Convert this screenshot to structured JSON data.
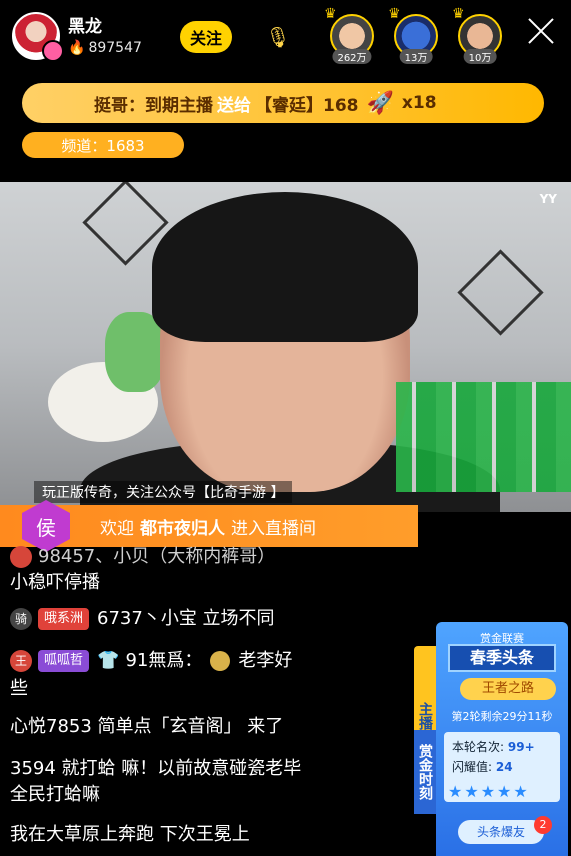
{
  "header": {
    "host_name": "黑龙",
    "host_fans": "897547",
    "follow_label": "关注",
    "viewers": [
      {
        "count": "262万"
      },
      {
        "count": "13万"
      },
      {
        "count": "10万"
      }
    ]
  },
  "gift_banner": {
    "sender": "挺哥：到期主播",
    "action": "送给",
    "receiver": "【睿廷】168",
    "quantity": "x18"
  },
  "channel": {
    "label": "频道：1683"
  },
  "video": {
    "logo": "YY",
    "promo": "玩正版传奇，关注公众号【比奇手游 】"
  },
  "welcome": {
    "badge": "侯",
    "prefix": "欢迎",
    "user": "都市夜归人",
    "suffix": "进入直播间"
  },
  "chat": [
    {
      "text": "98457、小贝（大称内裤哥）"
    },
    {
      "text": "小稳吓停播"
    },
    {
      "level": "骑",
      "tag": "哦系洲",
      "text": "6737丶小宝 立场不同"
    },
    {
      "level": "王",
      "tag": "呱呱哲",
      "user": "91無爲：",
      "text": "老李好"
    },
    {
      "text": "些"
    },
    {
      "text": "心悦7853 简单点「玄音阁」 来了"
    },
    {
      "text": "3594 就打蛤 嘛！以前故意碰瓷老毕"
    },
    {
      "text": "全民打蛤嘛"
    },
    {
      "text": "我在大草原上奔跑 下次王冕上"
    }
  ],
  "side_panel": {
    "tab1": "主播头条",
    "tab2": "赏金时刻",
    "title": "赏金联赛",
    "brand": "春季头条",
    "road": "王者之路",
    "round": "第2轮剩余29分11秒",
    "rank_label": "本轮名次:",
    "rank_value": "99+",
    "shine_label": "闪耀值:",
    "shine_value": "24",
    "news_button": "头条爆友",
    "news_count": "2"
  }
}
